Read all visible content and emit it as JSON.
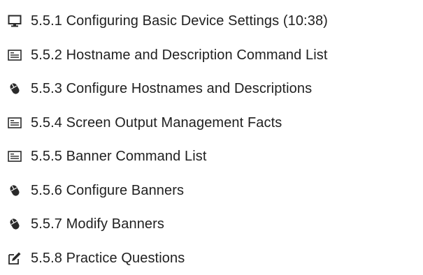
{
  "lessons": {
    "items": [
      {
        "label": "5.5.1 Configuring Basic Device Settings (10:38)",
        "icon": "monitor-icon"
      },
      {
        "label": "5.5.2 Hostname and Description Command List",
        "icon": "document-list-icon"
      },
      {
        "label": "5.5.3 Configure Hostnames and Descriptions",
        "icon": "mouse-icon"
      },
      {
        "label": "5.5.4 Screen Output Management Facts",
        "icon": "document-list-icon"
      },
      {
        "label": "5.5.5 Banner Command List",
        "icon": "document-list-icon"
      },
      {
        "label": "5.5.6 Configure Banners",
        "icon": "mouse-icon"
      },
      {
        "label": "5.5.7 Modify Banners",
        "icon": "mouse-icon"
      },
      {
        "label": "5.5.8 Practice Questions",
        "icon": "edit-checklist-icon"
      }
    ]
  },
  "colors": {
    "icon": "#2a2a2a",
    "text": "#1f1f1f",
    "background": "#ffffff"
  }
}
